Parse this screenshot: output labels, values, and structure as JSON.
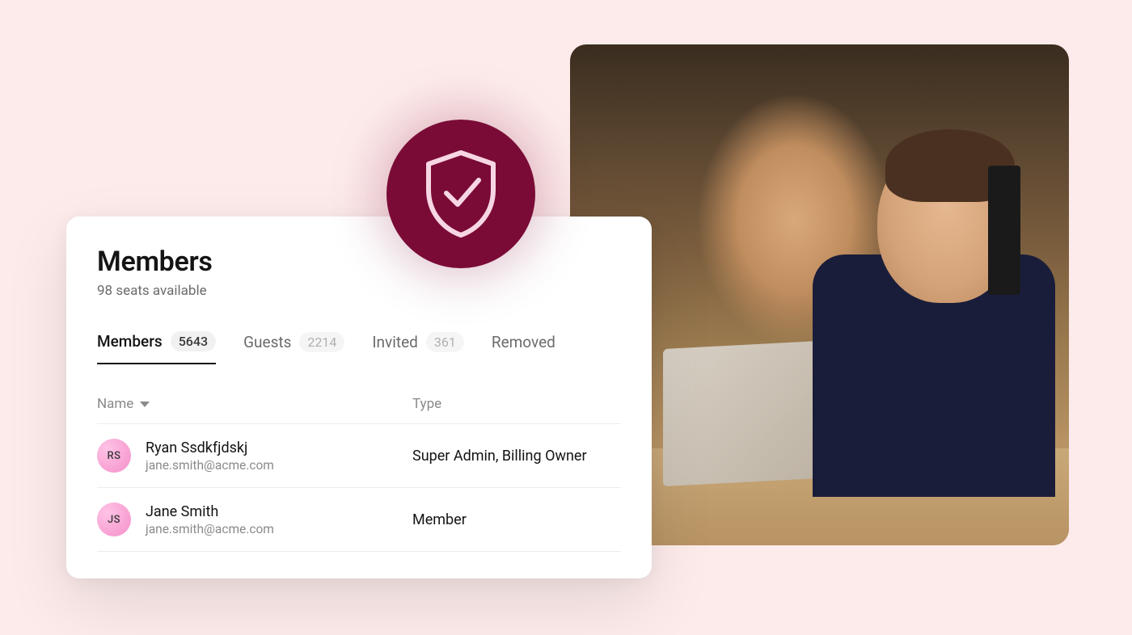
{
  "card": {
    "title": "Members",
    "subtitle": "98 seats available"
  },
  "tabs": [
    {
      "label": "Members",
      "count": "5643",
      "active": true
    },
    {
      "label": "Guests",
      "count": "2214",
      "active": false
    },
    {
      "label": "Invited",
      "count": "361",
      "active": false
    },
    {
      "label": "Removed",
      "count": null,
      "active": false
    }
  ],
  "columns": {
    "name": "Name",
    "type": "Type"
  },
  "rows": [
    {
      "initials": "RS",
      "name": "Ryan Ssdkfjdskj",
      "email": "jane.smith@acme.com",
      "type": "Super Admin, Billing Owner"
    },
    {
      "initials": "JS",
      "name": "Jane Smith",
      "email": "jane.smith@acme.com",
      "type": "Member"
    }
  ],
  "badge": {
    "name": "shield-check-icon"
  }
}
